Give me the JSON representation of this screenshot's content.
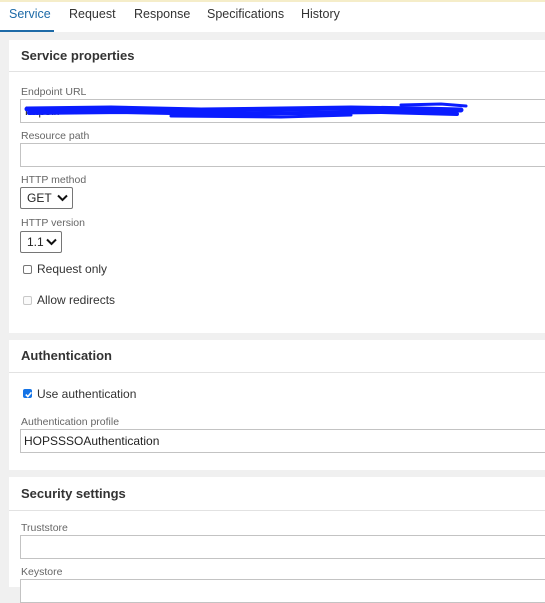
{
  "tabs": [
    {
      "label": "Service",
      "active": true
    },
    {
      "label": "Request",
      "active": false
    },
    {
      "label": "Response",
      "active": false
    },
    {
      "label": "Specifications",
      "active": false
    },
    {
      "label": "History",
      "active": false
    }
  ],
  "service_properties": {
    "title": "Service properties",
    "endpoint_url": {
      "label": "Endpoint URL",
      "value": "https://"
    },
    "resource_path": {
      "label": "Resource path",
      "value": ""
    },
    "http_method": {
      "label": "HTTP method",
      "value": "GET"
    },
    "http_version": {
      "label": "HTTP version",
      "value": "1.1"
    },
    "request_only": {
      "label": "Request only",
      "checked": false
    },
    "allow_redirects": {
      "label": "Allow redirects",
      "checked": false,
      "disabled": true
    }
  },
  "authentication": {
    "title": "Authentication",
    "use_authentication": {
      "label": "Use authentication",
      "checked": true
    },
    "profile": {
      "label": "Authentication profile",
      "value": "HOPSSSOAuthentication"
    }
  },
  "security_settings": {
    "title": "Security settings",
    "truststore": {
      "label": "Truststore",
      "value": ""
    },
    "keystore": {
      "label": "Keystore",
      "value": ""
    }
  },
  "colors": {
    "accent": "#1d6aa7",
    "redaction": "#0a1cff"
  }
}
